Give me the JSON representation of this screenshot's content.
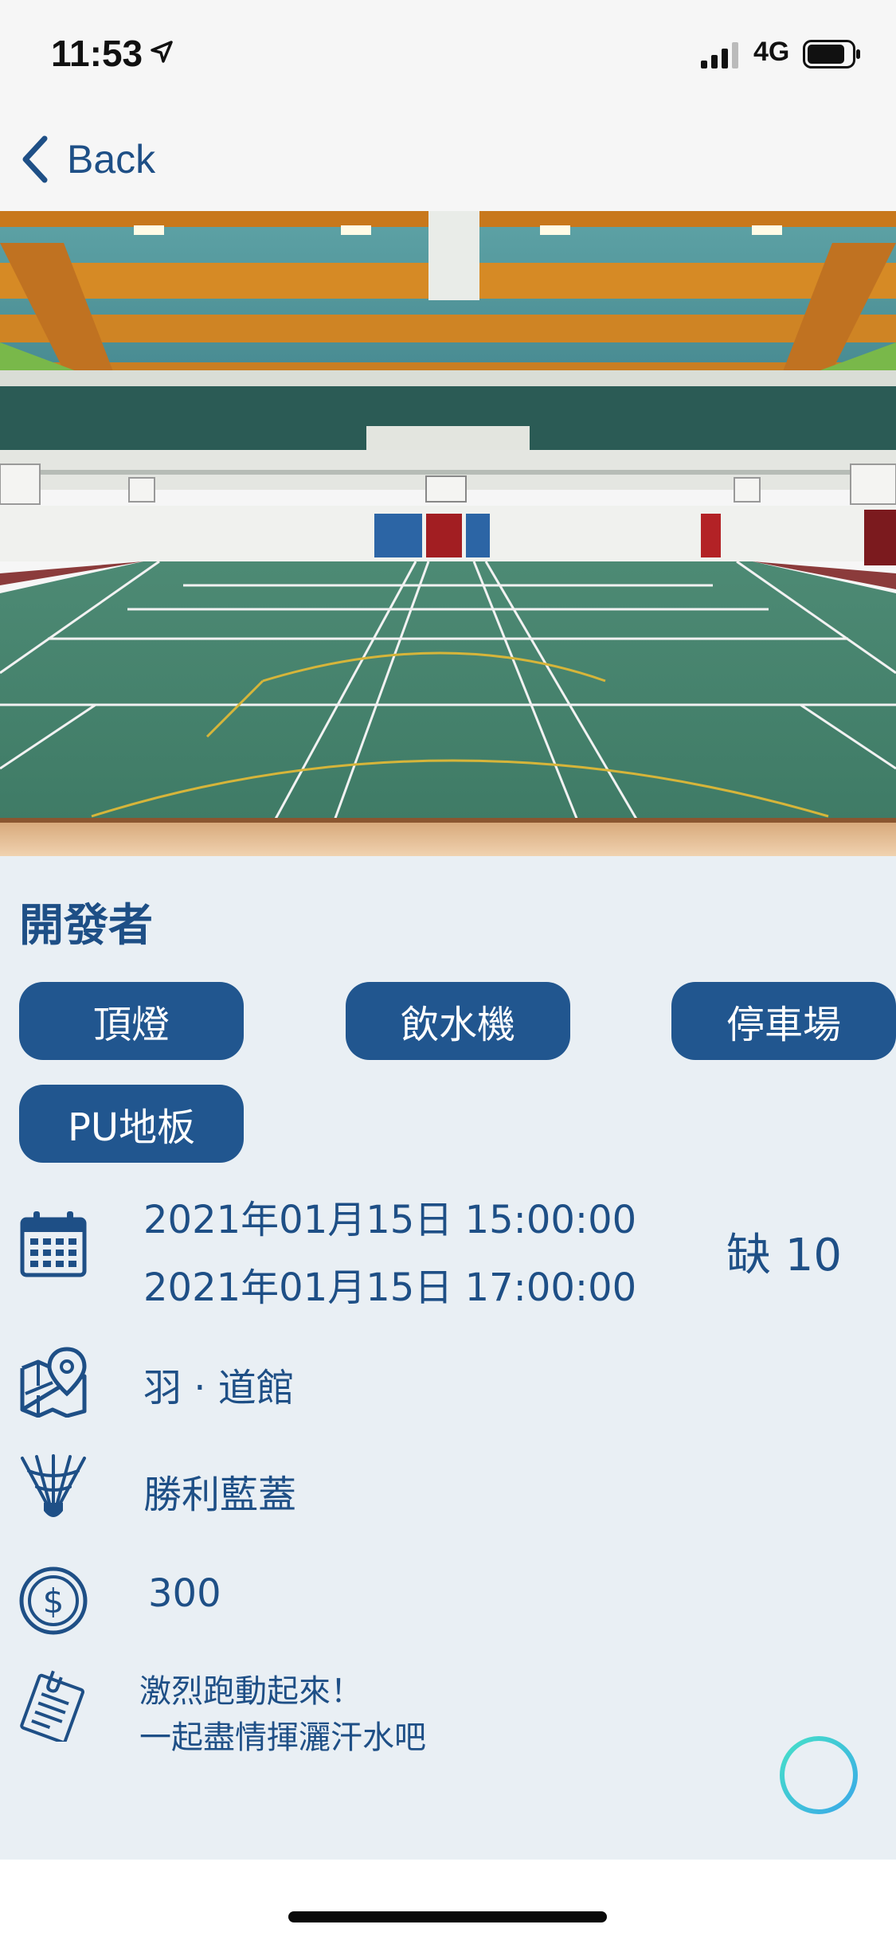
{
  "status_bar": {
    "time": "11:53",
    "network": "4G",
    "location_icon": "location-arrow-icon",
    "signal_icon": "cellular-signal-icon",
    "battery_icon": "battery-icon"
  },
  "nav": {
    "back_label": "Back",
    "back_icon": "chevron-left-icon"
  },
  "hero": {
    "image": "indoor badminton court photo"
  },
  "event": {
    "title": "開發者",
    "tags": [
      "頂燈",
      "飲水機",
      "停車場",
      "PU地板"
    ],
    "start_datetime": "2021年01月15日 15:00:00",
    "end_datetime": "2021年01月15日 17:00:00",
    "shortage": "缺 10",
    "venue": "羽 · 道館",
    "shuttlecock": "勝利藍蓋",
    "fee": "300",
    "note_lines": [
      "激烈跑動起來！",
      "一起盡情揮灑汗水吧"
    ]
  },
  "icons": {
    "calendar": "calendar-icon",
    "map": "map-pin-icon",
    "shuttlecock": "shuttlecock-icon",
    "coin": "dollar-coin-icon",
    "note": "note-clip-icon",
    "add": "add-circle-icon"
  },
  "colors": {
    "primary": "#21568f",
    "text": "#1e4f86",
    "content_bg": "#e9eff4",
    "add_button": "#4fd6d8"
  }
}
